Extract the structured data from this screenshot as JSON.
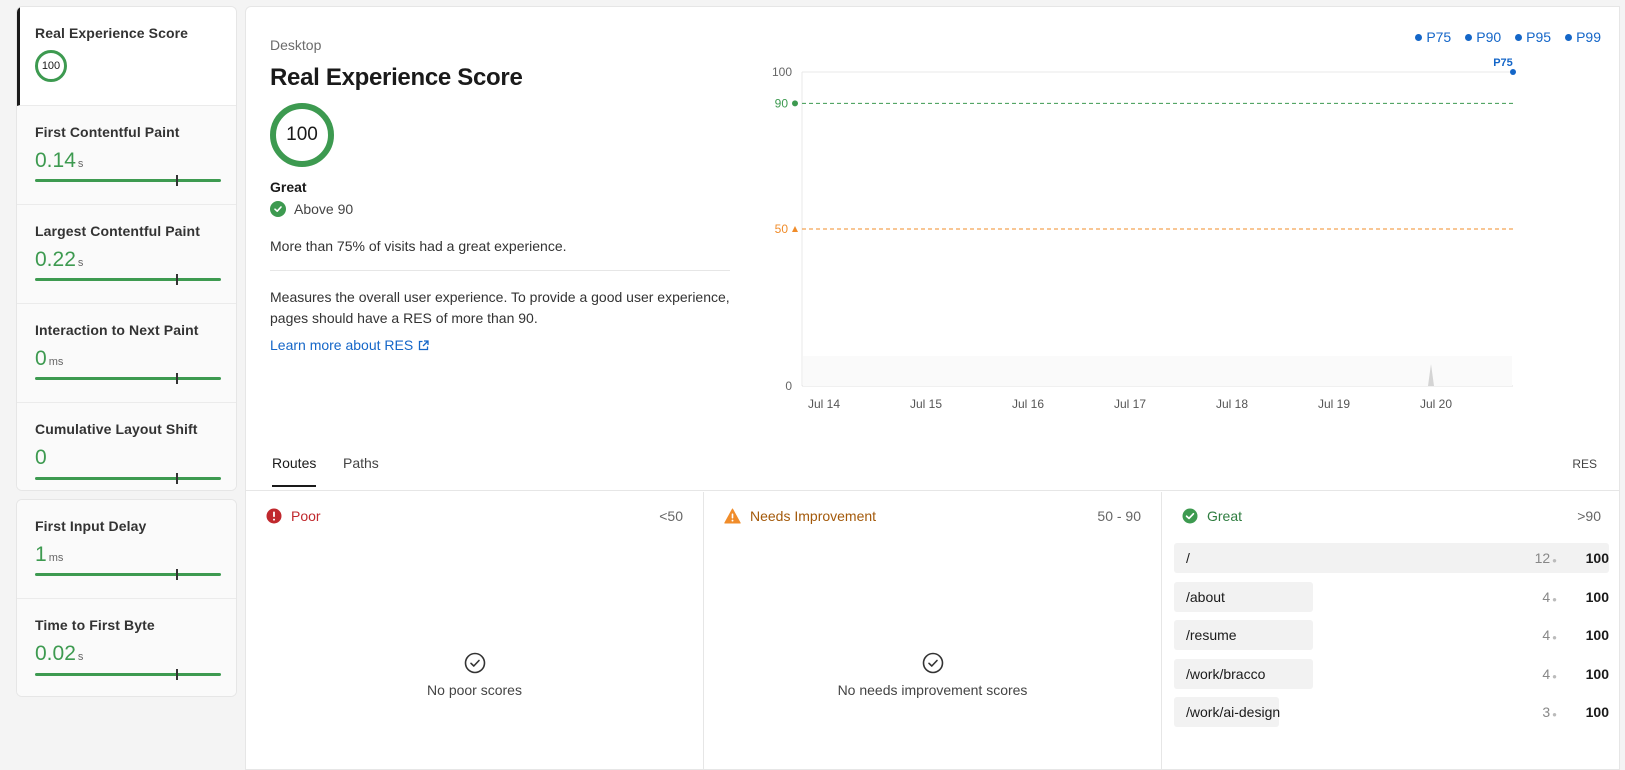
{
  "metrics_primary": [
    {
      "name": "Real Experience Score",
      "value": "100",
      "unit": ""
    },
    {
      "name": "First Contentful Paint",
      "value": "0.14",
      "unit": "s"
    },
    {
      "name": "Largest Contentful Paint",
      "value": "0.22",
      "unit": "s"
    },
    {
      "name": "Interaction to Next Paint",
      "value": "0",
      "unit": "ms"
    },
    {
      "name": "Cumulative Layout Shift",
      "value": "0",
      "unit": ""
    }
  ],
  "metrics_secondary": [
    {
      "name": "First Input Delay",
      "value": "1",
      "unit": "ms"
    },
    {
      "name": "Time to First Byte",
      "value": "0.02",
      "unit": "s"
    }
  ],
  "detail": {
    "device": "Desktop",
    "title": "Real Experience Score",
    "score": "100",
    "rating": "Great",
    "threshold": "Above 90",
    "summary": "More than 75% of visits had a great experience.",
    "description": "Measures the overall user experience. To provide a good user experience, pages should have a RES of more than 90.",
    "learn_more": "Learn more about RES"
  },
  "legend": [
    "P75",
    "P90",
    "P95",
    "P99"
  ],
  "chart_data": {
    "type": "line",
    "x": [
      "Jul 14",
      "Jul 15",
      "Jul 16",
      "Jul 17",
      "Jul 18",
      "Jul 19",
      "Jul 20"
    ],
    "ylim": [
      0,
      100
    ],
    "yticks": [
      "100",
      "90",
      "50",
      "0"
    ],
    "thresholds": [
      {
        "value": 90,
        "label": "90",
        "color": "#3d9a50"
      },
      {
        "value": 50,
        "label": "50",
        "color": "#f08c2a"
      }
    ],
    "series": [
      {
        "name": "P75",
        "values": [
          {
            "x": "Jul 20",
            "y": 100
          }
        ]
      }
    ],
    "point_label": "P75"
  },
  "tabs": {
    "routes": "Routes",
    "paths": "Paths",
    "res": "RES"
  },
  "columns": {
    "poor": {
      "label": "Poor",
      "range": "<50",
      "empty": "No poor scores"
    },
    "needs": {
      "label": "Needs Improvement",
      "range": "50 - 90",
      "empty": "No needs improvement scores"
    },
    "great": {
      "label": "Great",
      "range": ">90"
    }
  },
  "routes": [
    {
      "path": "/",
      "count": "12",
      "score": "100",
      "bar_fraction": 1.0
    },
    {
      "path": "/about",
      "count": "4",
      "score": "100",
      "bar_fraction": 0.33
    },
    {
      "path": "/resume",
      "count": "4",
      "score": "100",
      "bar_fraction": 0.33
    },
    {
      "path": "/work/bracco",
      "count": "4",
      "score": "100",
      "bar_fraction": 0.33
    },
    {
      "path": "/work/ai-design",
      "count": "3",
      "score": "100",
      "bar_fraction": 0.25
    }
  ],
  "colors": {
    "great": "#3d9a50",
    "needs": "#f08c2a",
    "poor": "#c0282d",
    "link": "#1466c8"
  }
}
